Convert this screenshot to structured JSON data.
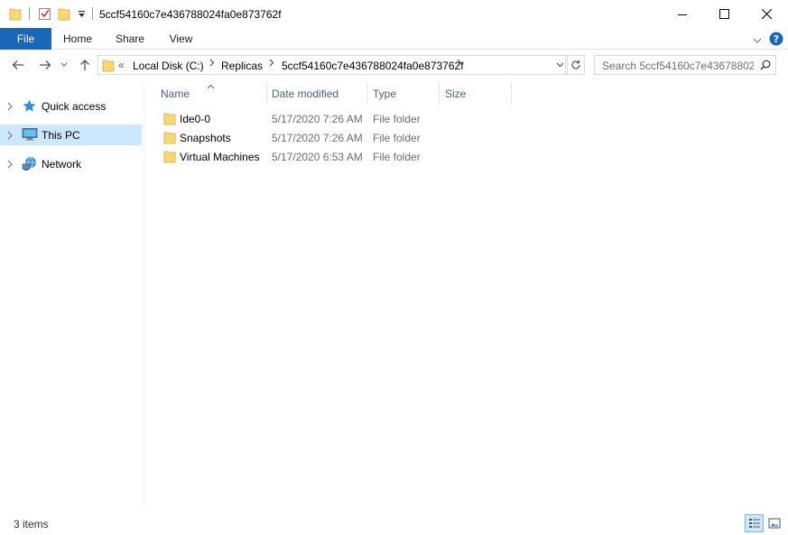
{
  "window": {
    "title": "5ccf54160c7e436788024fa0e873762f",
    "minimize_glyph": "—",
    "maximize_glyph": "☐",
    "close_glyph": "✕"
  },
  "ribbon": {
    "tabs": [
      "File",
      "Home",
      "Share",
      "View"
    ]
  },
  "address": {
    "overflow": "«",
    "crumbs": [
      "Local Disk (C:)",
      "Replicas",
      "5ccf54160c7e436788024fa0e873762f"
    ]
  },
  "search": {
    "placeholder": "Search 5ccf54160c7e43678802..."
  },
  "nav": {
    "items": [
      {
        "label": "Quick access",
        "icon": "star-icon",
        "selected": false
      },
      {
        "label": "This PC",
        "icon": "computer-icon",
        "selected": true
      },
      {
        "label": "Network",
        "icon": "network-icon",
        "selected": false
      }
    ]
  },
  "columns": {
    "name": "Name",
    "date": "Date modified",
    "type": "Type",
    "size": "Size"
  },
  "files": [
    {
      "name": "Ide0-0",
      "date": "5/17/2020 7:26 AM",
      "type": "File folder"
    },
    {
      "name": "Snapshots",
      "date": "5/17/2020 7:26 AM",
      "type": "File folder"
    },
    {
      "name": "Virtual Machines",
      "date": "5/17/2020 6:53 AM",
      "type": "File folder"
    }
  ],
  "status": {
    "count": "3 items"
  },
  "colors": {
    "file_tab": "#1a66b7",
    "selection": "#cce8ff",
    "folder": "#f8d775",
    "header_text": "#4c607a"
  }
}
